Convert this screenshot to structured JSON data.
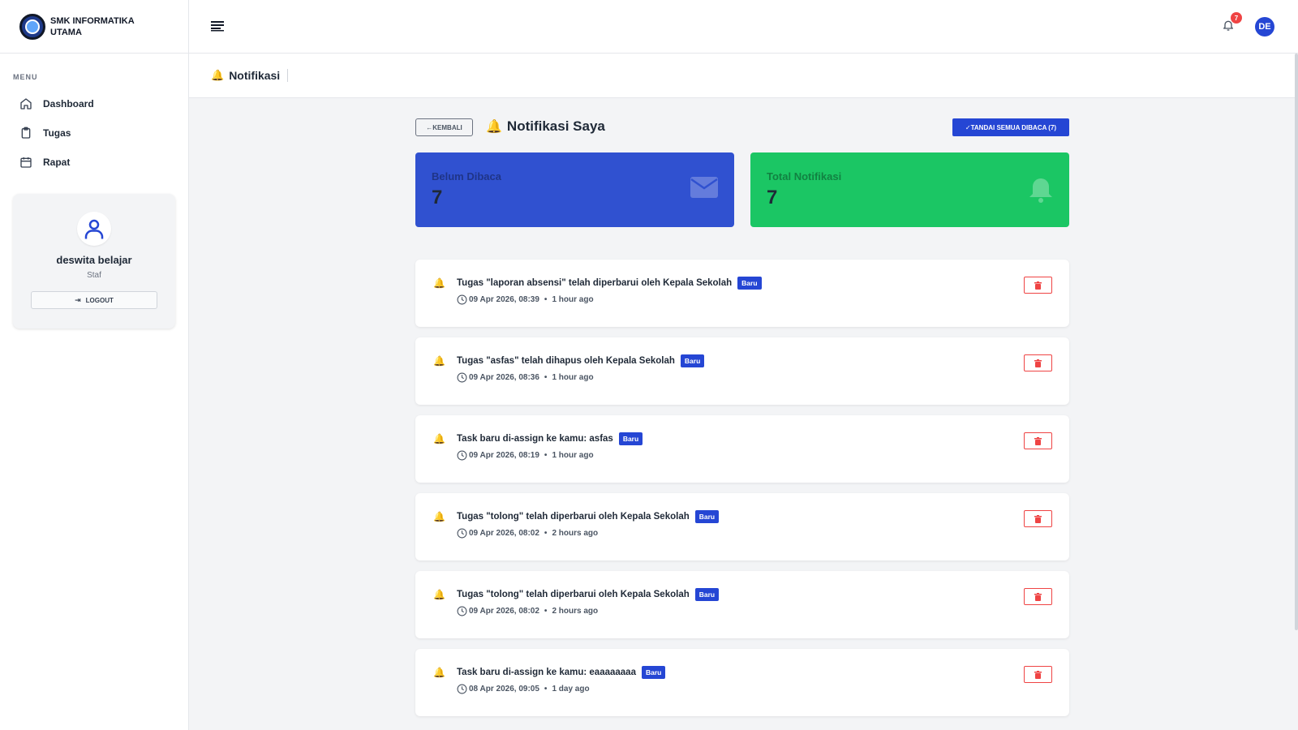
{
  "brand": {
    "name": "SMK INFORMATIKA UTAMA"
  },
  "sidebar": {
    "menu_title": "MENU",
    "items": [
      {
        "label": "Dashboard",
        "icon": "home-icon"
      },
      {
        "label": "Tugas",
        "icon": "clipboard-icon"
      },
      {
        "label": "Rapat",
        "icon": "calendar-icon"
      }
    ],
    "profile": {
      "name": "deswita belajar",
      "role": "Staf",
      "logout_label": "LOGOUT"
    }
  },
  "topbar": {
    "notification_count": "7",
    "user_initials": "DE"
  },
  "page_header": {
    "title": "Notifikasi"
  },
  "main": {
    "back_label": "←KEMBALI",
    "title": "Notifikasi Saya",
    "mark_all_label": "✓TANDAI SEMUA DIBACA (7)"
  },
  "stats": {
    "unread": {
      "label": "Belum Dibaca",
      "value": "7",
      "color": "#3051d0"
    },
    "total": {
      "label": "Total Notifikasi",
      "value": "7",
      "color": "#1bc664"
    }
  },
  "notifications": [
    {
      "text": "Tugas \"laporan absensi\" telah diperbarui oleh Kepala Sekolah",
      "badge": "Baru",
      "date": "09 Apr 2026, 08:39",
      "ago": "1 hour ago"
    },
    {
      "text": "Tugas \"asfas\" telah dihapus oleh Kepala Sekolah",
      "badge": "Baru",
      "date": "09 Apr 2026, 08:36",
      "ago": "1 hour ago"
    },
    {
      "text": "Task baru di-assign ke kamu: asfas",
      "badge": "Baru",
      "date": "09 Apr 2026, 08:19",
      "ago": "1 hour ago"
    },
    {
      "text": "Tugas \"tolong\" telah diperbarui oleh Kepala Sekolah",
      "badge": "Baru",
      "date": "09 Apr 2026, 08:02",
      "ago": "2 hours ago"
    },
    {
      "text": "Tugas \"tolong\" telah diperbarui oleh Kepala Sekolah",
      "badge": "Baru",
      "date": "09 Apr 2026, 08:02",
      "ago": "2 hours ago"
    },
    {
      "text": "Task baru di-assign ke kamu: eaaaaaaaa",
      "badge": "Baru",
      "date": "08 Apr 2026, 09:05",
      "ago": "1 day ago"
    }
  ],
  "colors": {
    "primary": "#2546d4",
    "success": "#1bc664",
    "danger": "#ef4444"
  }
}
